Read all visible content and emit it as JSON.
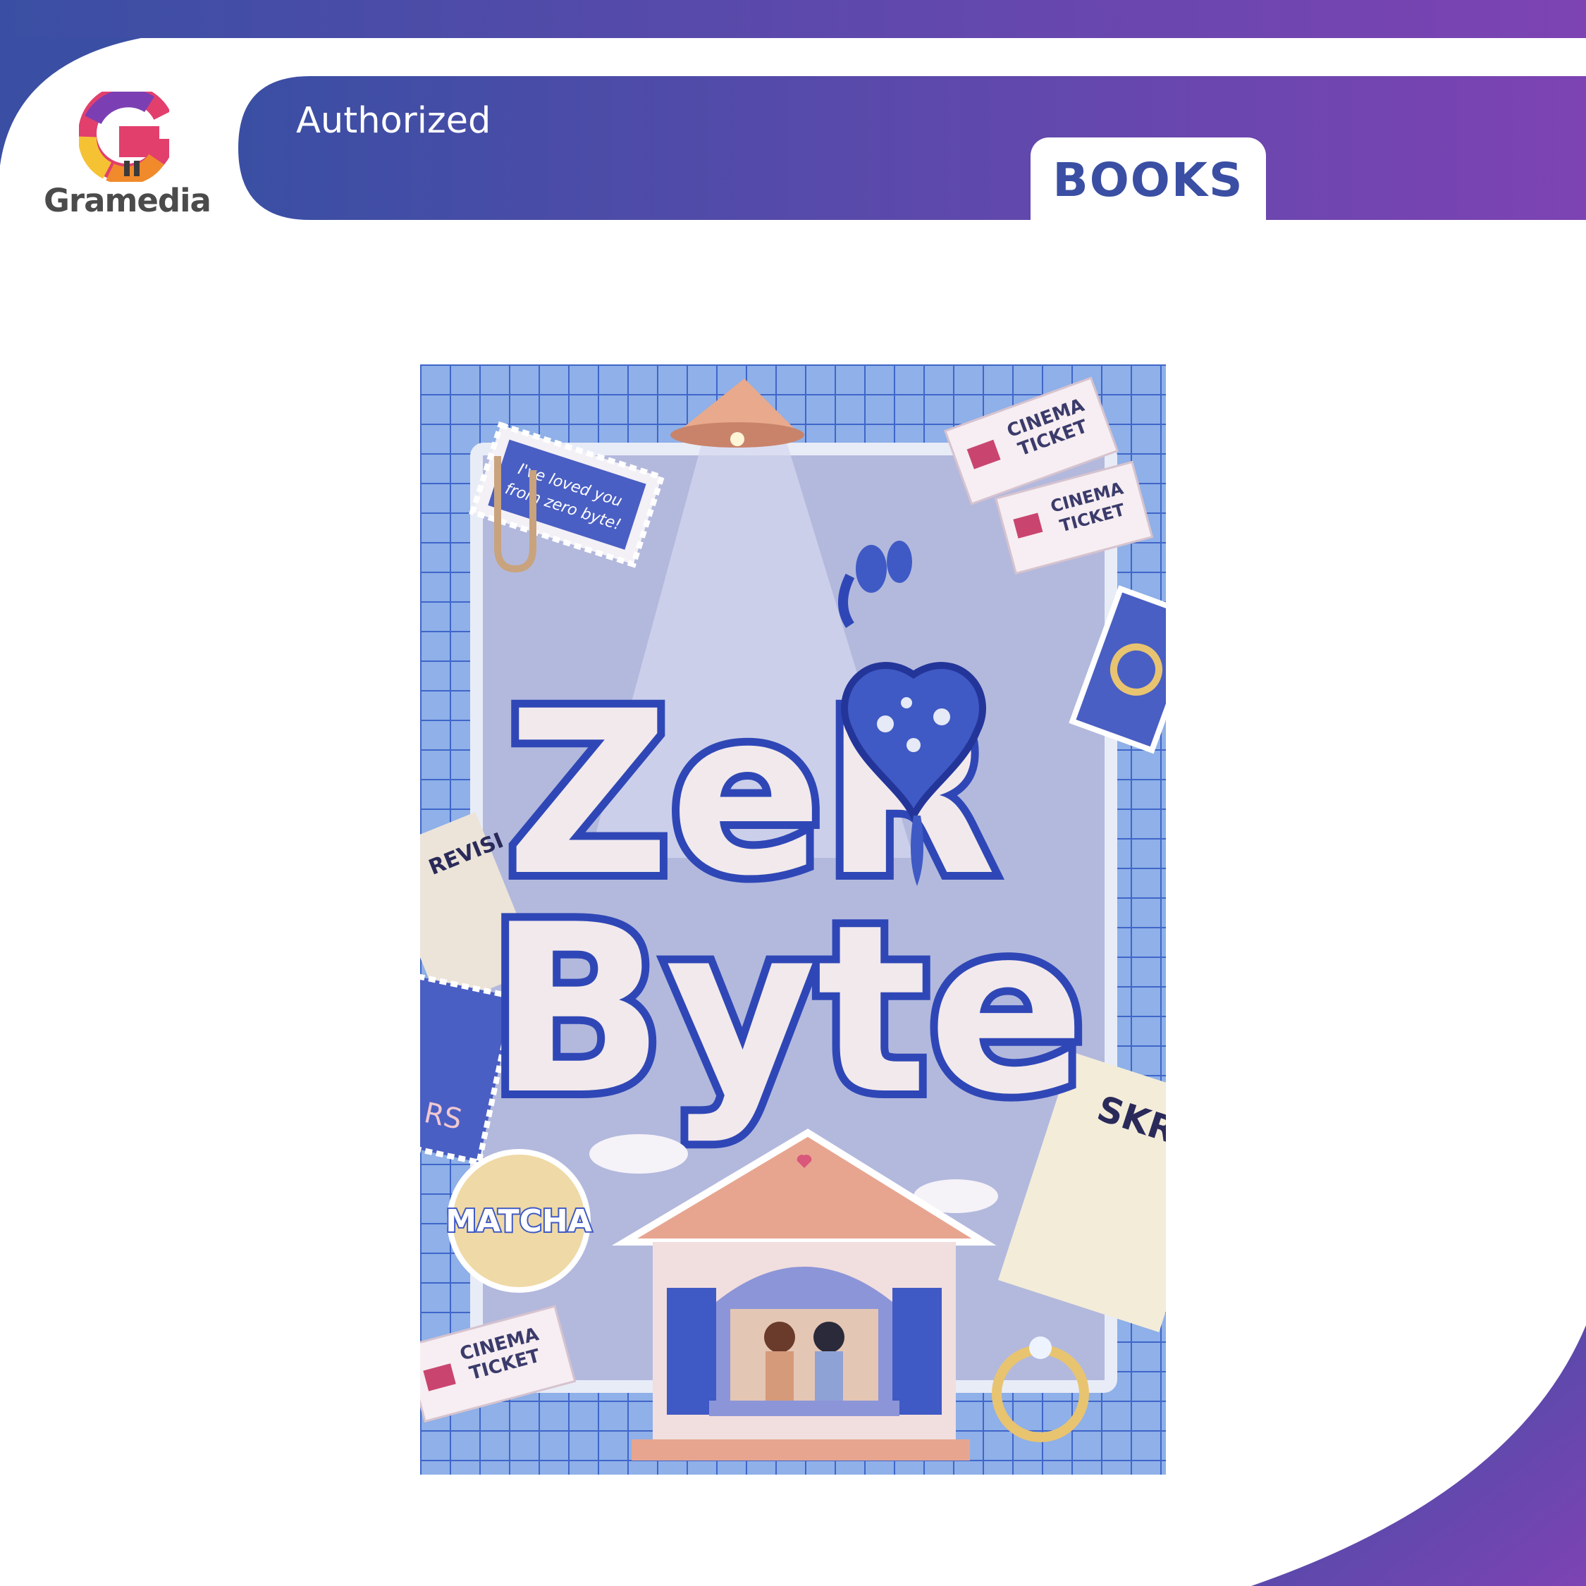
{
  "brand": {
    "name": "Gramedia",
    "badge": "Authorized",
    "category": "BOOKS"
  },
  "colors": {
    "banner_start": "#3a4fa3",
    "banner_end": "#7d43b3",
    "accent_text": "#3a4fa3"
  },
  "icons": {
    "logo": "gramedia-g-logo"
  },
  "cover": {
    "title_line1": "ZeR",
    "title_line2": "Byte",
    "tagline_line1": "I've loved you",
    "tagline_line2": "from zero byte!",
    "author": "MATCHA",
    "ticket_line1": "CINEMA",
    "ticket_line2": "TICKET",
    "note_fragment": "SKR",
    "side_text_1": "REVISI",
    "side_text_2": "RS"
  }
}
